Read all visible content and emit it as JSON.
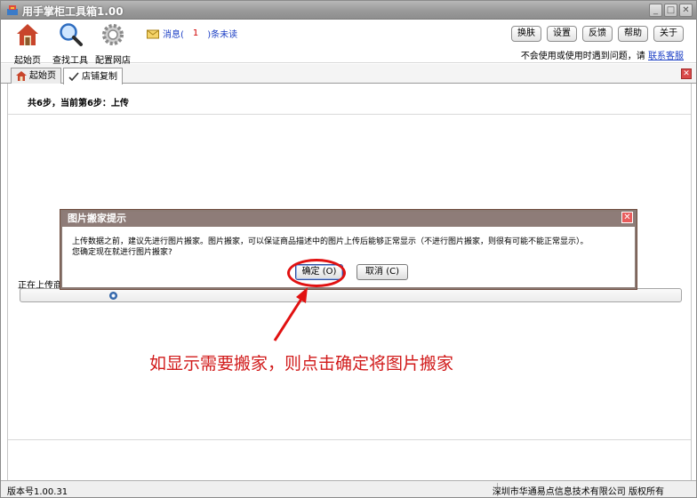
{
  "window": {
    "title": "用手掌柜工具箱1.00"
  },
  "toolbar": {
    "home_label": "起始页",
    "search_label": "查找工具",
    "config_label": "配置网店",
    "message_prefix": "消息(",
    "message_count": "1",
    "message_suffix": ")条未读",
    "buttons": [
      "换肤",
      "设置",
      "反馈",
      "帮助",
      "关于"
    ],
    "help_text": "不会使用或使用时遇到问题，请",
    "help_link": "联系客服"
  },
  "tabs": [
    {
      "label": "起始页"
    },
    {
      "label": "店铺复制"
    }
  ],
  "content": {
    "step_text": "共6步，当前第6步：上传",
    "uploading_text": "正在上传商品"
  },
  "dialog": {
    "title": "图片搬家提示",
    "message_line1": "上传数据之前，建议先进行图片搬家。图片搬家，可以保证商品描述中的图片上传后能够正常显示（不进行图片搬家，则很有可能不能正常显示）。",
    "message_line2": "您确定现在就进行图片搬家?",
    "ok_label": "确定 (O)",
    "cancel_label": "取消 (C)"
  },
  "annotation": {
    "text": "如显示需要搬家，则点击确定将图片搬家"
  },
  "statusbar": {
    "version": "版本号1.00.31",
    "copyright": "深圳市华通易点信息技术有限公司 版权所有"
  },
  "colors": {
    "annotation": "#e11111",
    "link": "#1c3fc5",
    "dialog_border": "#8b7a74"
  }
}
